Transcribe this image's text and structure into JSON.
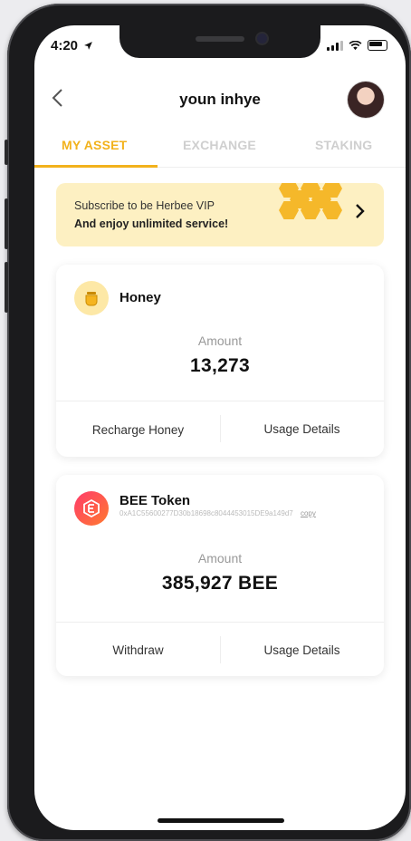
{
  "status": {
    "time": "4:20"
  },
  "header": {
    "title": "youn inhye"
  },
  "tabs": [
    {
      "label": "MY ASSET"
    },
    {
      "label": "EXCHANGE"
    },
    {
      "label": "STAKING"
    }
  ],
  "banner": {
    "line1": "Subscribe to be Herbee VIP",
    "line2": "And enjoy unlimited service!"
  },
  "honey_card": {
    "name": "Honey",
    "amount_label": "Amount",
    "amount": "13,273",
    "action_left": "Recharge Honey",
    "action_right": "Usage Details"
  },
  "bee_card": {
    "name": "BEE Token",
    "address": "0xA1C55600277D30b18698c8044453015DE9a149d7",
    "copy_label": "copy",
    "amount_label": "Amount",
    "amount": "385,927 BEE",
    "action_left": "Withdraw",
    "action_right": "Usage Details"
  },
  "colors": {
    "accent": "#f2b21c",
    "banner_bg": "#fdf0c2",
    "bee_gradient_start": "#ff3b6b",
    "bee_gradient_end": "#ff7a2f"
  },
  "icons": [
    "back-chevron-icon",
    "honey-pot-icon",
    "bee-token-icon",
    "chevron-right-icon",
    "signal-icon",
    "wifi-icon",
    "battery-icon",
    "location-arrow-icon"
  ]
}
